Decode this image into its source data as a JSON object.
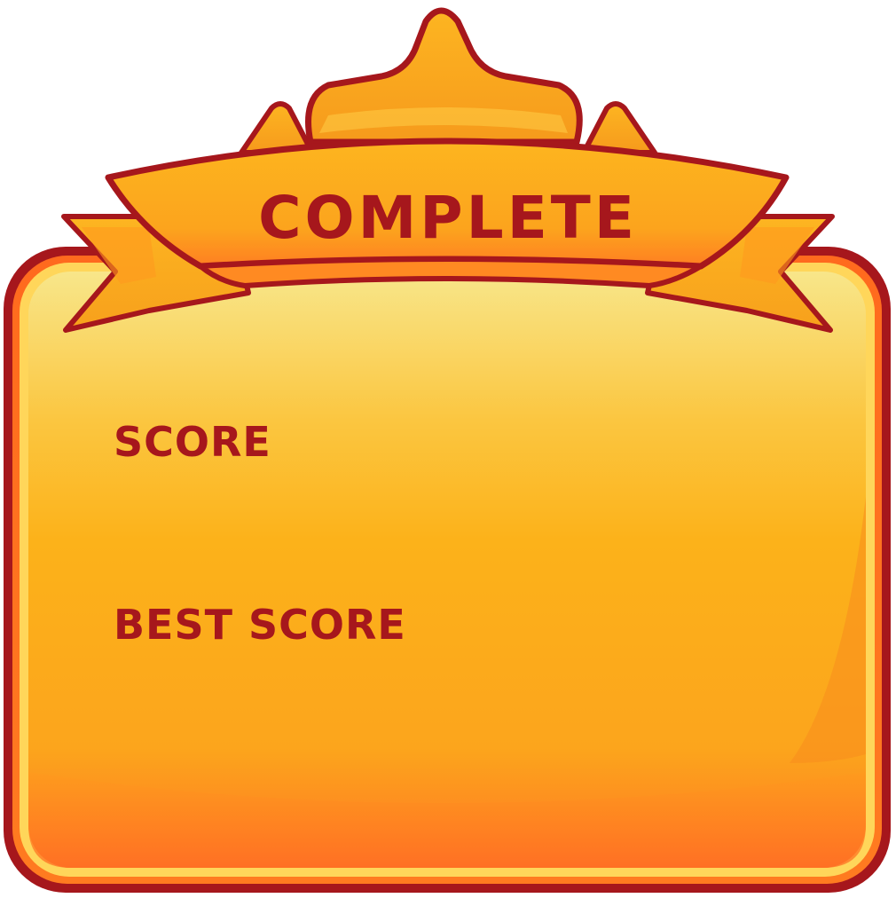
{
  "panel": {
    "title": "COMPLETE",
    "score_label": "SCORE",
    "best_score_label": "BEST SCORE"
  },
  "colors": {
    "outline": "#a6171c",
    "frame": "#ff7424",
    "panel_top": "#f8e27a",
    "panel_mid": "#fcb01a",
    "panel_bottom": "#ff7a22",
    "crown": "#fdb521",
    "text": "#a6171c"
  }
}
